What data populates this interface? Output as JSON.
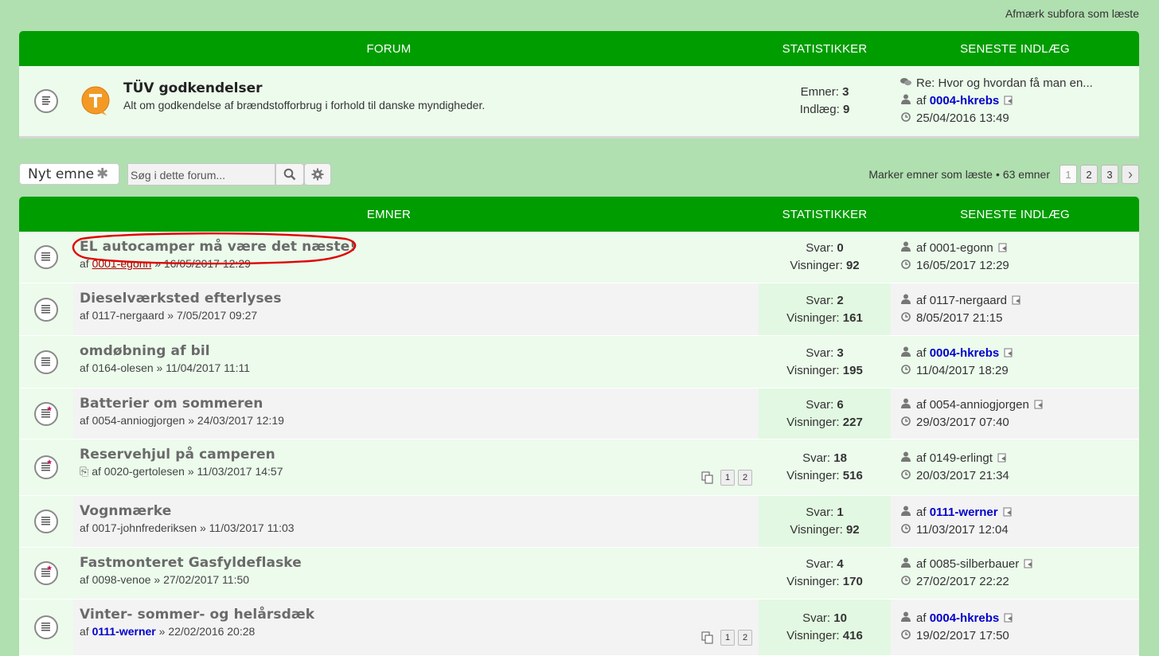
{
  "top_link": "Afmærk subfora som læste",
  "forum_panel": {
    "headers": {
      "forum": "FORUM",
      "stats": "STATISTIKKER",
      "last": "SENESTE INDLÆG"
    },
    "forum": {
      "title": "TÜV godkendelser",
      "description": "Alt om godkendelse af brændstofforbrug i forhold til danske myndigheder.",
      "topics_label": "Emner:",
      "topics": "3",
      "posts_label": "Indlæg:",
      "posts": "9",
      "last_subject": "Re: Hvor og hvordan få man en...",
      "last_by_prefix": "af",
      "last_author": "0004-hkrebs",
      "last_time": "25/04/2016 13:49"
    }
  },
  "action_bar": {
    "new_topic": "Nyt emne",
    "search_placeholder": "Søg i dette forum...",
    "mark_read": "Marker emner som læste",
    "separator": "•",
    "topic_count": "63 emner",
    "pages": [
      "1",
      "2",
      "3"
    ],
    "next": "›"
  },
  "topics_panel": {
    "headers": {
      "topics": "EMNER",
      "stats": "STATISTIKKER",
      "last": "SENESTE INDLÆG"
    },
    "replies_label": "Svar:",
    "views_label": "Visninger:",
    "by": "af",
    "topics": [
      {
        "title": "EL autocamper må være det næste!",
        "meta_author": "0001-egonn",
        "meta_date": "» 16/05/2017 12:29",
        "replies": "0",
        "views": "92",
        "last_author": "0001-egonn",
        "last_time": "16/05/2017 12:29"
      },
      {
        "title": "Dieselværksted efterlyses",
        "meta_author": "0117-nergaard",
        "meta_date": "» 7/05/2017 09:27",
        "replies": "2",
        "views": "161",
        "last_author": "0117-nergaard",
        "last_time": "8/05/2017 21:15"
      },
      {
        "title": "omdøbning af bil",
        "meta_author": "0164-olesen",
        "meta_date": "» 11/04/2017 11:11",
        "replies": "3",
        "views": "195",
        "last_author": "0004-hkrebs",
        "last_time": "11/04/2017 18:29"
      },
      {
        "title": "Batterier om sommeren",
        "meta_author": "0054-anniogjorgen",
        "meta_date": "» 24/03/2017 12:19",
        "replies": "6",
        "views": "227",
        "last_author": "0054-anniogjorgen",
        "last_time": "29/03/2017 07:40"
      },
      {
        "title": "Reservehjul på camperen",
        "meta_author": "0020-gertolesen",
        "meta_date": "» 11/03/2017 14:57",
        "replies": "18",
        "views": "516",
        "last_author": "0149-erlingt",
        "last_time": "20/03/2017 21:34",
        "pages": [
          "1",
          "2"
        ]
      },
      {
        "title": "Vognmærke",
        "meta_author": "0017-johnfrederiksen",
        "meta_date": "» 11/03/2017 11:03",
        "replies": "1",
        "views": "92",
        "last_author": "0111-werner",
        "last_time": "11/03/2017 12:04"
      },
      {
        "title": "Fastmonteret Gasfyldeflaske",
        "meta_author": "0098-venoe",
        "meta_date": "» 27/02/2017 11:50",
        "replies": "4",
        "views": "170",
        "last_author": "0085-silberbauer",
        "last_time": "27/02/2017 22:22"
      },
      {
        "title": "Vinter- sommer- og helårsdæk",
        "meta_author": "0111-werner",
        "meta_date": "» 22/02/2016 20:28",
        "replies": "10",
        "views": "416",
        "last_author": "0004-hkrebs",
        "last_time": "19/02/2017 17:50",
        "pages": [
          "1",
          "2"
        ]
      }
    ]
  },
  "colors": {
    "header_green": "#009d00",
    "page_bg": "#b0dfb0",
    "user_blue": "#0000cc",
    "annotation_red": "#e00000"
  }
}
